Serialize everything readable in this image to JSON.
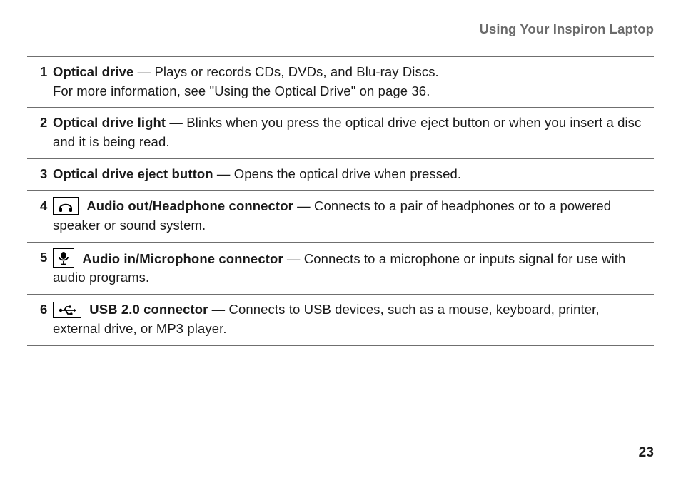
{
  "header": "Using Your Inspiron Laptop",
  "page_number": "23",
  "items": [
    {
      "num": "1",
      "term": "Optical drive",
      "desc": " — Plays or records CDs, DVDs, and Blu-ray Discs.",
      "extra": "For more information, see \"Using the Optical Drive\" on page 36.",
      "icon": null
    },
    {
      "num": "2",
      "term": "Optical drive light",
      "desc": " — Blinks when you press the optical drive eject button or when you insert a disc and it is being read.",
      "extra": null,
      "icon": null
    },
    {
      "num": "3",
      "term": "Optical drive eject button",
      "desc": " — Opens the optical drive when pressed.",
      "extra": null,
      "icon": null
    },
    {
      "num": "4",
      "term": "Audio out/Headphone connector",
      "desc": " — Connects to a pair of headphones or to a powered speaker or sound system.",
      "extra": null,
      "icon": "headphone"
    },
    {
      "num": "5",
      "term": "Audio in/Microphone connector",
      "desc": " — Connects to a microphone or inputs signal for use with audio programs.",
      "extra": null,
      "icon": "microphone"
    },
    {
      "num": "6",
      "term": "USB 2.0 connector",
      "desc": " — Connects to USB devices, such as a mouse, keyboard, printer, external drive, or MP3 player.",
      "extra": null,
      "icon": "usb"
    }
  ]
}
